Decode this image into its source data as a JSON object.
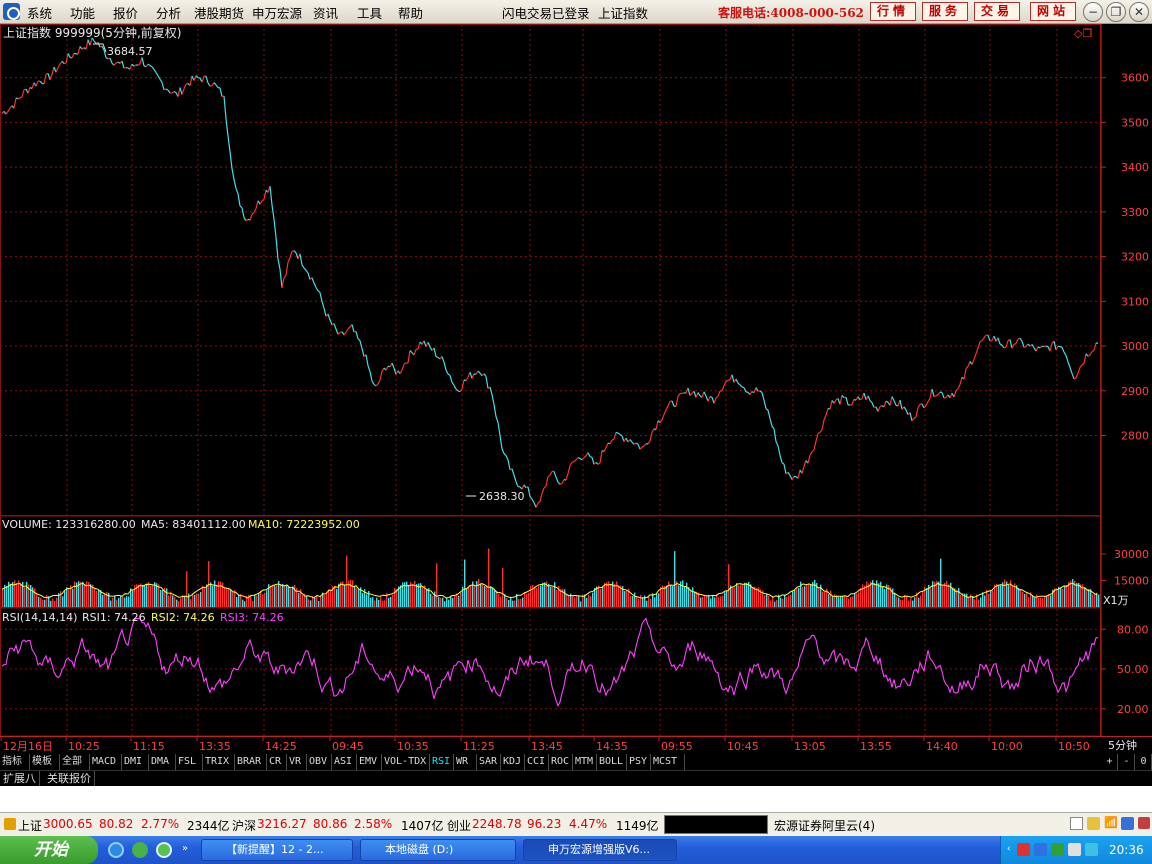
{
  "menu": {
    "items": [
      "系统",
      "功能",
      "报价",
      "分析",
      "港股期货",
      "申万宏源",
      "资讯",
      "工具",
      "帮助"
    ],
    "status1": "闪电交易已登录",
    "status2": "上证指数",
    "hotline": "客服电话:4008-000-562",
    "buttons": [
      "行情",
      "服务",
      "交易",
      "网站"
    ]
  },
  "chart": {
    "title": "上证指数 999999(5分钟,前复权)",
    "high_label": "3684.57",
    "low_label": "2638.30",
    "price_ticks": [
      "3600",
      "3500",
      "3400",
      "3300",
      "3200",
      "3100",
      "3000",
      "2900",
      "2800"
    ],
    "volume_info": {
      "label": "VOLUME: 123316280.00",
      "ma5": "MA5: 83401112.00",
      "ma10": "MA10: 72223952.00"
    },
    "volume_ticks": [
      "30000",
      "15000"
    ],
    "volume_unit": "X1万",
    "rsi_info": {
      "label": "RSI(14,14,14)",
      "rsi1": "RSI1: 74.26",
      "rsi2": "RSI2: 74.26",
      "rsi3": "RSI3: 74.26"
    },
    "rsi_ticks": [
      "80.00",
      "50.00",
      "20.00"
    ],
    "time_labels": [
      "12月16日",
      "10:25",
      "11:15",
      "13:35",
      "14:25",
      "09:45",
      "10:35",
      "11:25",
      "13:45",
      "14:35",
      "09:55",
      "10:45",
      "13:05",
      "13:55",
      "14:40",
      "10:00",
      "10:50"
    ],
    "period": "5分钟",
    "colors": {
      "up": "#ff3030",
      "down": "#40e0e8",
      "ma": "#ffff40",
      "rsi": "#ff40ff",
      "grid": "#8a1010"
    }
  },
  "chart_data": {
    "type": "line",
    "title": "上证指数 999999(5分钟,前复权)",
    "ylim": [
      2620,
      3720
    ],
    "y_ticks": [
      2800,
      2900,
      3000,
      3100,
      3200,
      3300,
      3400,
      3500,
      3600
    ],
    "series": [
      {
        "values": [
          3520,
          3540,
          3570,
          3590,
          3600,
          3630,
          3650,
          3670,
          3684.57,
          3650,
          3630,
          3620,
          3640,
          3610,
          3580,
          3560,
          3590,
          3600,
          3590,
          3560,
          3350,
          3280,
          3320,
          3360,
          3130,
          3220,
          3180,
          3130,
          3060,
          3020,
          3040,
          2990,
          2900,
          2960,
          2940,
          2980,
          3010,
          2990,
          2960,
          2900,
          2930,
          2950,
          2900,
          2760,
          2700,
          2680,
          2638.3,
          2720,
          2690,
          2740,
          2760,
          2730,
          2790,
          2800,
          2790,
          2770,
          2820,
          2860,
          2880,
          2900,
          2890,
          2880,
          2920,
          2930,
          2900,
          2900,
          2830,
          2730,
          2700,
          2740,
          2800,
          2870,
          2880,
          2870,
          2890,
          2860,
          2880,
          2870,
          2840,
          2870,
          2900,
          2890,
          2900,
          2960,
          3010,
          3020,
          3000,
          3010,
          3000,
          2990,
          3000,
          3000,
          2930,
          2980,
          3010
        ]
      }
    ],
    "annotations": [
      "3684.57",
      "2638.30"
    ]
  },
  "tabs": [
    "指标",
    "模板",
    "全部",
    "MACD",
    "DMI",
    "DMA",
    "FSL",
    "TRIX",
    "BRAR",
    "CR",
    "VR",
    "OBV",
    "ASI",
    "EMV",
    "VOL-TDX",
    "RSI",
    "WR",
    "SAR",
    "KDJ",
    "CCI",
    "ROC",
    "MTM",
    "BOLL",
    "PSY",
    "MCST"
  ],
  "tab_controls": [
    "+",
    "-",
    "0"
  ],
  "subtabs": [
    "扩展八",
    "关联报价"
  ],
  "statusbar": {
    "sh_label": "上证",
    "sh_value": "3000.65",
    "sh_change": "80.82",
    "sh_pct": "2.77%",
    "sh_amount": "2344亿",
    "hs_label": "沪深",
    "hs_value": "3216.27",
    "hs_change": "80.86",
    "hs_pct": "2.58%",
    "hs_amount": "1407亿",
    "cy_label": "创业",
    "cy_value": "2248.78",
    "cy_change": "96.23",
    "cy_pct": "4.47%",
    "cy_amount": "1149亿",
    "broker": "宏源证券阿里云(4)"
  },
  "taskbar": {
    "start": "开始",
    "tasks": [
      "【新提醒】12 - 2...",
      "本地磁盘 (D:)",
      "申万宏源增强版V6..."
    ],
    "clock": "20:36"
  }
}
